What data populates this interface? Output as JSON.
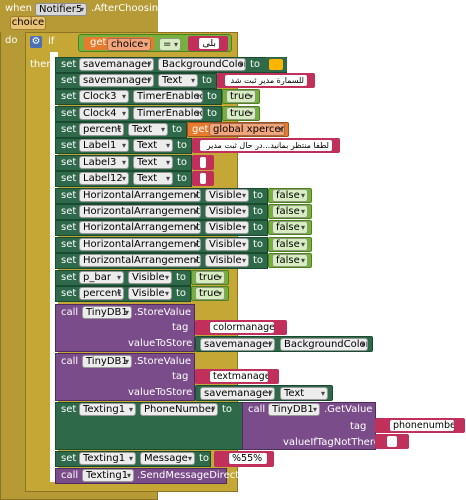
{
  "event": {
    "when": "when",
    "component": "Notifier5",
    "event_name": ".AfterChoosing",
    "param": "choice",
    "do": "do",
    "if": "if",
    "then": "then"
  },
  "condition": {
    "get": "get",
    "var": "choice",
    "op": "=",
    "value": "بلى"
  },
  "setters": [
    {
      "kw": "set",
      "comp": "savemanager",
      "prop": "BackgroundColor",
      "to": "to"
    },
    {
      "kw": "set",
      "comp": "savemanager",
      "prop": "Text",
      "to": "to",
      "str": "للسمارة مدير ثبت شد"
    },
    {
      "kw": "set",
      "comp": "Clock3",
      "prop": "TimerEnabled",
      "to": "to",
      "bool": "true"
    },
    {
      "kw": "set",
      "comp": "Clock4",
      "prop": "TimerEnabled",
      "to": "to",
      "bool": "true"
    },
    {
      "kw": "set",
      "comp": "percent",
      "prop": "Text",
      "to": "to",
      "get": "get",
      "var": "global xpercent"
    },
    {
      "kw": "set",
      "comp": "Label1",
      "prop": "Text",
      "to": "to",
      "str": "لطفا منتظر بمانید...در حال ثبت مدیر"
    },
    {
      "kw": "set",
      "comp": "Label3",
      "prop": "Text",
      "to": "to",
      "str": ""
    },
    {
      "kw": "set",
      "comp": "Label12",
      "prop": "Text",
      "to": "to",
      "str": ""
    },
    {
      "kw": "set",
      "comp": "HorizontalArrangement1",
      "prop": "Visible",
      "to": "to",
      "bool": "false"
    },
    {
      "kw": "set",
      "comp": "HorizontalArrangement2",
      "prop": "Visible",
      "to": "to",
      "bool": "false"
    },
    {
      "kw": "set",
      "comp": "HorizontalArrangement3",
      "prop": "Visible",
      "to": "to",
      "bool": "false"
    },
    {
      "kw": "set",
      "comp": "HorizontalArrangement5",
      "prop": "Visible",
      "to": "to",
      "bool": "false"
    },
    {
      "kw": "set",
      "comp": "HorizontalArrangement7",
      "prop": "Visible",
      "to": "to",
      "bool": "false"
    },
    {
      "kw": "set",
      "comp": "p_bar",
      "prop": "Visible",
      "to": "to",
      "bool": "true"
    },
    {
      "kw": "set",
      "comp": "percent",
      "prop": "Visible",
      "to": "to",
      "bool": "true"
    }
  ],
  "store1": {
    "call": "call",
    "comp": "TinyDB1",
    "method": ".StoreValue",
    "tag_label": "tag",
    "tag": "colormanager",
    "vts_label": "valueToStore",
    "vcomp": "savemanager",
    "vprop": "BackgroundColor"
  },
  "store2": {
    "call": "call",
    "comp": "TinyDB1",
    "method": ".StoreValue",
    "tag_label": "tag",
    "tag": "textmanager",
    "vts_label": "valueToStore",
    "vcomp": "savemanager",
    "vprop": "Text"
  },
  "setphone": {
    "kw": "set",
    "comp": "Texting1",
    "prop": "PhoneNumber",
    "to": "to",
    "call": "call",
    "gcomp": "TinyDB1",
    "method": ".GetValue",
    "tag_label": "tag",
    "tag": "phonenumber",
    "ifnt": "valueIfTagNotThere",
    "ifnt_val": ""
  },
  "setmsg": {
    "kw": "set",
    "comp": "Texting1",
    "prop": "Message",
    "to": "to",
    "str": "%55%"
  },
  "send": {
    "call": "call",
    "comp": "Texting1",
    "method": ".SendMessageDirect"
  },
  "colors": {
    "event": "#b59a35",
    "control": "#c4a735",
    "set": "#2e6a4a",
    "call": "#7a4d8a",
    "logic": "#78b040",
    "text": "#b83062",
    "var": "#e3702a",
    "orange": "#ffb400"
  }
}
